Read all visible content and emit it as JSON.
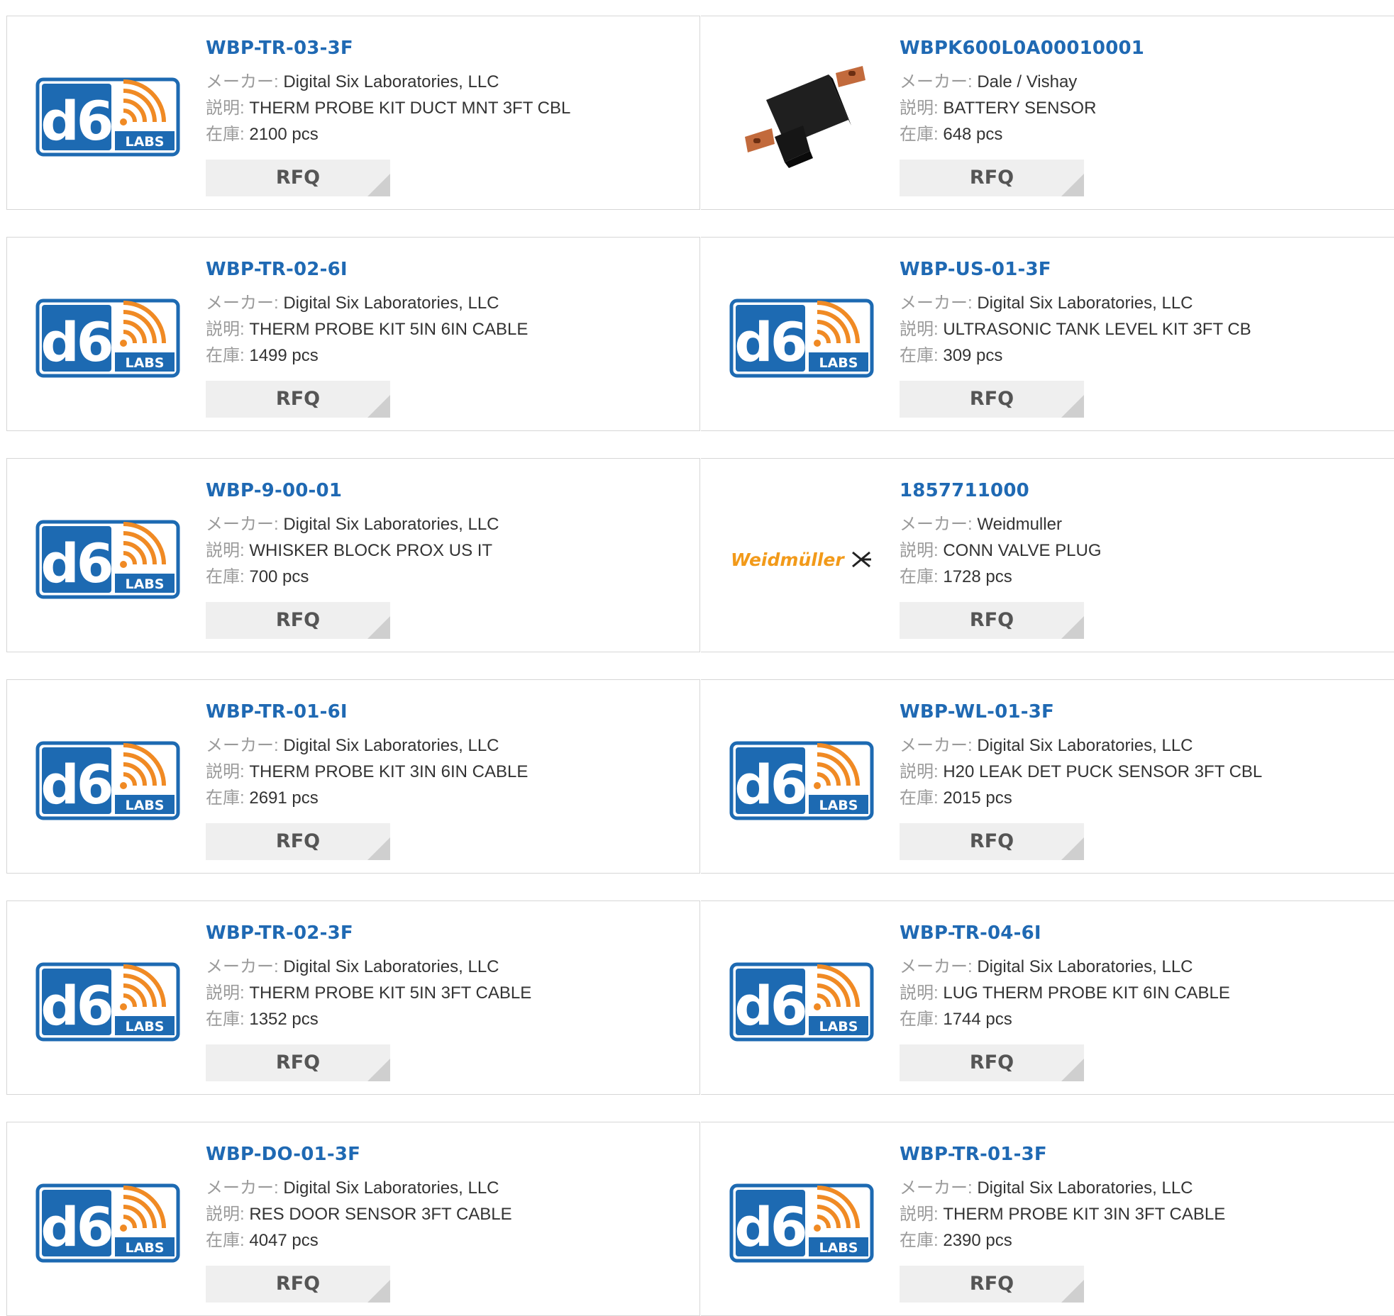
{
  "labels": {
    "maker": "メーカー:",
    "desc": "説明:",
    "stock": "在庫:",
    "rfq": "RFQ"
  },
  "logos": {
    "d6": {
      "main": "d6",
      "sub": "LABS",
      "blue": "#1d6ab2",
      "orange": "#f08a24"
    },
    "weidmuller": {
      "text": "Weidmüller",
      "color": "#f29a1a"
    }
  },
  "products": [
    {
      "part": "WBP-TR-03-3F",
      "maker": "Digital Six Laboratories, LLC",
      "desc": "THERM PROBE KIT DUCT MNT 3FT CBL",
      "stock": "2100 pcs",
      "image": "d6-labs-logo"
    },
    {
      "part": "WBPK600L0A00010001",
      "maker": "Dale / Vishay",
      "desc": "BATTERY SENSOR",
      "stock": "648 pcs",
      "image": "battery-sensor-photo"
    },
    {
      "part": "WBP-TR-02-6I",
      "maker": "Digital Six Laboratories, LLC",
      "desc": "THERM PROBE KIT 5IN 6IN CABLE",
      "stock": "1499 pcs",
      "image": "d6-labs-logo"
    },
    {
      "part": "WBP-US-01-3F",
      "maker": "Digital Six Laboratories, LLC",
      "desc": "ULTRASONIC TANK LEVEL KIT 3FT CB",
      "stock": "309 pcs",
      "image": "d6-labs-logo"
    },
    {
      "part": "WBP-9-00-01",
      "maker": "Digital Six Laboratories, LLC",
      "desc": "WHISKER BLOCK PROX US IT",
      "stock": "700 pcs",
      "image": "d6-labs-logo"
    },
    {
      "part": "1857711000",
      "maker": "Weidmuller",
      "desc": "CONN VALVE PLUG",
      "stock": "1728 pcs",
      "image": "weidmuller-logo"
    },
    {
      "part": "WBP-TR-01-6I",
      "maker": "Digital Six Laboratories, LLC",
      "desc": "THERM PROBE KIT 3IN 6IN CABLE",
      "stock": "2691 pcs",
      "image": "d6-labs-logo"
    },
    {
      "part": "WBP-WL-01-3F",
      "maker": "Digital Six Laboratories, LLC",
      "desc": "H20 LEAK DET PUCK SENSOR 3FT CBL",
      "stock": "2015 pcs",
      "image": "d6-labs-logo"
    },
    {
      "part": "WBP-TR-02-3F",
      "maker": "Digital Six Laboratories, LLC",
      "desc": "THERM PROBE KIT 5IN 3FT CABLE",
      "stock": "1352 pcs",
      "image": "d6-labs-logo"
    },
    {
      "part": "WBP-TR-04-6I",
      "maker": "Digital Six Laboratories, LLC",
      "desc": "LUG THERM PROBE KIT 6IN CABLE",
      "stock": "1744 pcs",
      "image": "d6-labs-logo"
    },
    {
      "part": "WBP-DO-01-3F",
      "maker": "Digital Six Laboratories, LLC",
      "desc": "RES DOOR SENSOR 3FT CABLE",
      "stock": "4047 pcs",
      "image": "d6-labs-logo"
    },
    {
      "part": "WBP-TR-01-3F",
      "maker": "Digital Six Laboratories, LLC",
      "desc": "THERM PROBE KIT 3IN 3FT CABLE",
      "stock": "2390 pcs",
      "image": "d6-labs-logo"
    }
  ]
}
